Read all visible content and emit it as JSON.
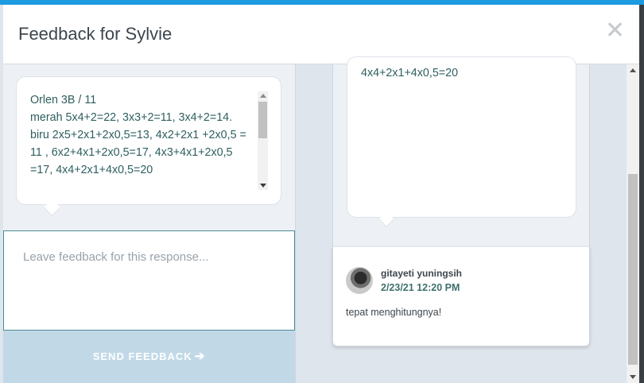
{
  "modal": {
    "title": "Feedback for Sylvie",
    "close_icon": "close-icon"
  },
  "response": {
    "text": "Orlen 3B / 11\nmerah 5x4+2=22, 3x3+2=11, 3x4+2=14.\nbiru 2x5+2x1+2x0,5=13, 4x2+2x1 +2x0,5 = 11 , 6x2+4x1+2x0,5=17, 4x3+4x1+2x0,5 =17, 4x4+2x1+4x0,5=20"
  },
  "feedback": {
    "placeholder": "Leave feedback for this response...",
    "send_label": "SEND FEEDBACK",
    "send_icon": "arrow-right-icon"
  },
  "thread": {
    "response_tail": "4x4+2x1+4x0,5=20",
    "comment": {
      "author": "gitayeti yuningsih",
      "timestamp": "2/23/21 12:20 PM",
      "text": "tepat menghitungnya!"
    }
  },
  "colors": {
    "accent": "#1e9be0",
    "send_button": "#c1d9e7",
    "text_teal": "#2f5f5f"
  }
}
